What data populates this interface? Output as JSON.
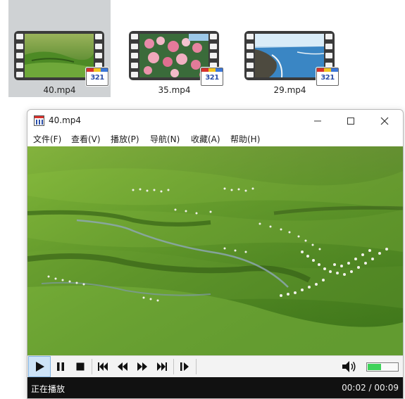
{
  "files": [
    {
      "name": "40.mp4",
      "selected": true,
      "badge": "321",
      "thumb": "grassland"
    },
    {
      "name": "35.mp4",
      "selected": false,
      "badge": "321",
      "thumb": "flowers"
    },
    {
      "name": "29.mp4",
      "selected": false,
      "badge": "321",
      "thumb": "coast"
    }
  ],
  "window": {
    "title": "40.mp4",
    "controls": {
      "minimize": "minimize-icon",
      "maximize": "maximize-icon",
      "close": "close-icon"
    }
  },
  "menu": [
    "文件(F)",
    "查看(V)",
    "播放(P)",
    "导航(N)",
    "收藏(A)",
    "帮助(H)"
  ],
  "playback": {
    "buttons": [
      "play",
      "pause",
      "stop",
      "previous",
      "rewind",
      "fast-forward",
      "next",
      "frame-step"
    ],
    "volume_fraction": 0.45,
    "status": "正在播放",
    "time": "00:02 / 00:09"
  },
  "colors": {
    "accent": "#cde3f7",
    "volume": "#3fd25a",
    "statusbar": "#111111",
    "selection": "#cfd2d4"
  }
}
